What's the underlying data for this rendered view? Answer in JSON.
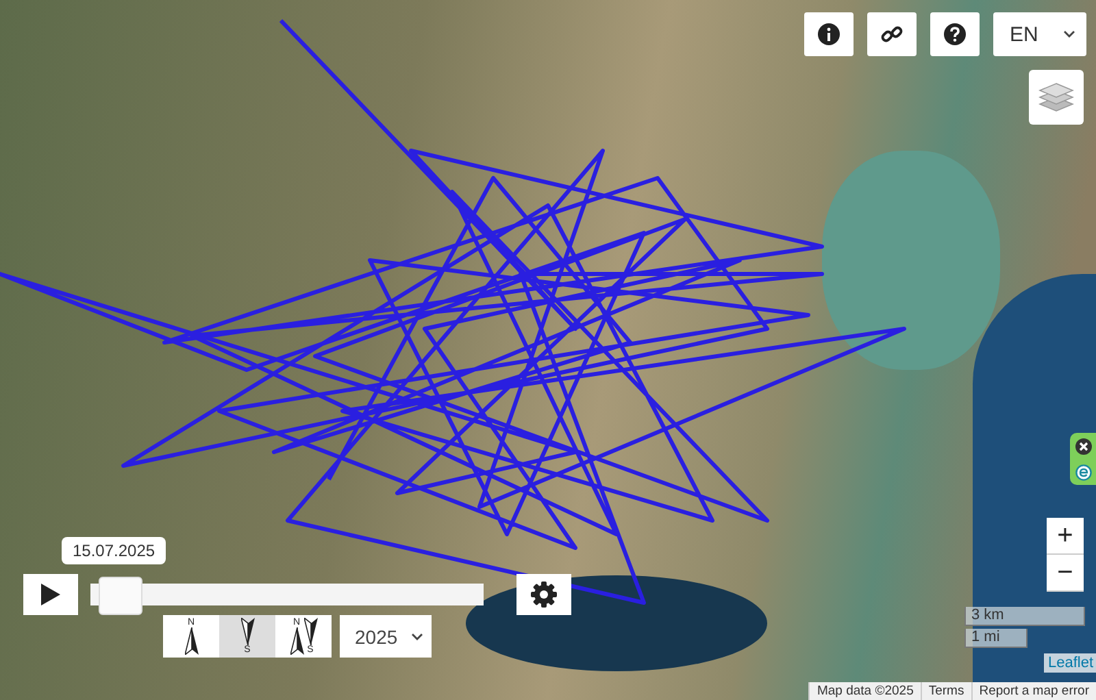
{
  "toolbar": {
    "buttons": [
      {
        "kind": "info"
      },
      {
        "kind": "link"
      },
      {
        "kind": "help"
      }
    ],
    "language": "EN"
  },
  "timeline": {
    "date": "15.07.2025",
    "level": 0.02
  },
  "view_modes": [
    {
      "kind": "north",
      "labels": [
        "N"
      ],
      "selected": false
    },
    {
      "kind": "south",
      "labels": [
        "S"
      ],
      "selected": true
    },
    {
      "kind": "both",
      "labels": [
        "N",
        "S"
      ],
      "selected": false
    }
  ],
  "year": "2025",
  "zoom": {
    "in": "+",
    "out": "−"
  },
  "scale": [
    "3 km",
    "1 mi"
  ],
  "leaflet": "Leaflet",
  "attribution": [
    "Map data ©2025",
    "Terms",
    "Report a map error"
  ]
}
